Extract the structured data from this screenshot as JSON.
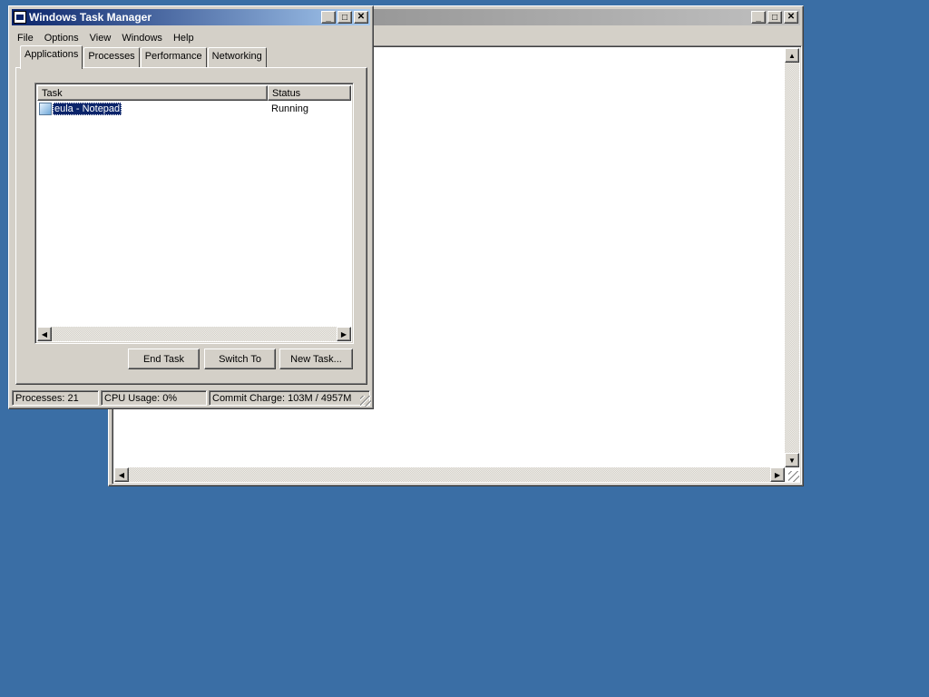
{
  "desktop": {
    "background": "#3a6ea5"
  },
  "notepad": {
    "title": "",
    "buttons": {
      "minimize": "_",
      "maximize": "□",
      "close": "✕"
    },
    "scroll_up": "▲",
    "scroll_down": "▼",
    "scroll_left": "◀",
    "scroll_right": "▶"
  },
  "taskmgr": {
    "title": "Windows Task Manager",
    "buttons": {
      "minimize": "_",
      "maximize": "□",
      "close": "✕"
    },
    "menu": [
      {
        "label": "File"
      },
      {
        "label": "Options"
      },
      {
        "label": "View"
      },
      {
        "label": "Windows"
      },
      {
        "label": "Help"
      }
    ],
    "tabs": [
      {
        "label": "Applications"
      },
      {
        "label": "Processes"
      },
      {
        "label": "Performance"
      },
      {
        "label": "Networking"
      }
    ],
    "selected_tab": "Applications",
    "columns": {
      "task": "Task",
      "status": "Status"
    },
    "rows": [
      {
        "task": "eula - Notepad",
        "status": "Running",
        "icon": "notepad-icon",
        "selected": true
      }
    ],
    "scroll_left": "◀",
    "scroll_right": "▶",
    "actions": {
      "end_task": "End Task",
      "switch_to": "Switch To",
      "new_task": "New Task..."
    },
    "status": {
      "processes": "Processes: 21",
      "cpu": "CPU Usage: 0%",
      "commit": "Commit Charge: 103M / 4957M"
    },
    "colors": {
      "title_active": "#0a246a",
      "selection": "#0a246a",
      "face": "#d4d0c8"
    }
  }
}
